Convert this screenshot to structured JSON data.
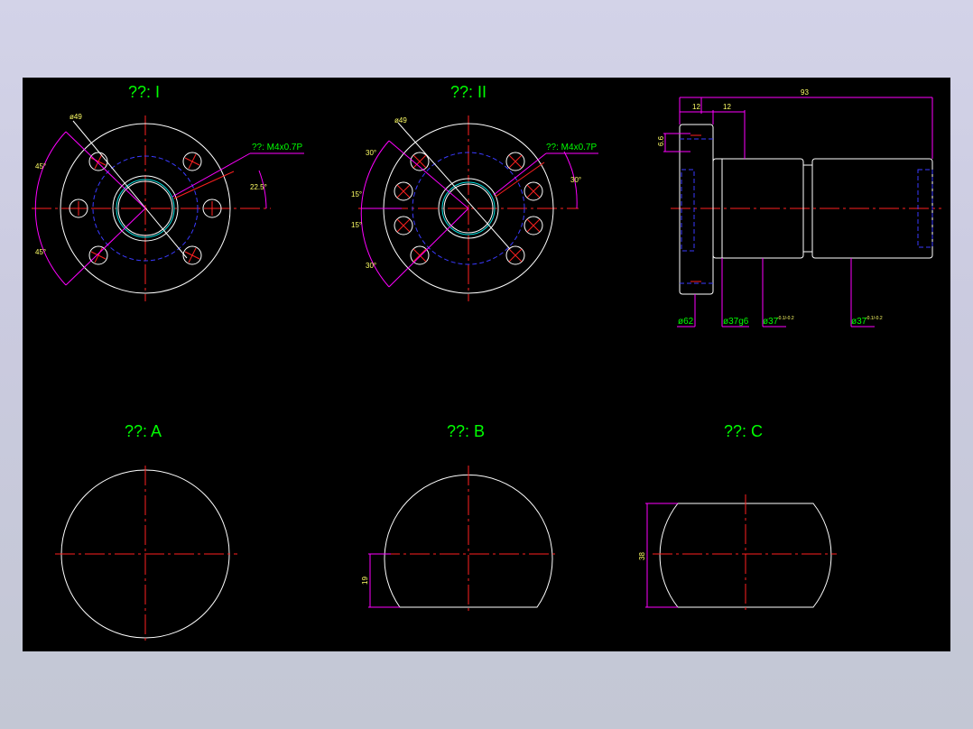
{
  "colors": {
    "background": "#000000",
    "outline": "#ffffff",
    "centerline": "#ff2020",
    "hidden": "#3a3aff",
    "dimension": "#ff00ff",
    "text": "#00ff00",
    "small_text": "#ffff66"
  },
  "views": {
    "view1_title": "??: I",
    "view2_title": "??: II",
    "viewA_title": "??: A",
    "viewB_title": "??: B",
    "viewC_title": "??: C"
  },
  "labels": {
    "v1_bolt_circle": "ø49",
    "v1_thread": "??: M4x0.7P",
    "v1_angle_top": "45°",
    "v1_angle_bottom": "45°",
    "v1_angle_thread": "22.5°",
    "v2_bolt_circle": "ø49",
    "v2_thread": "??: M4x0.7P",
    "v2_angle_a": "30°",
    "v2_angle_b": "15°",
    "v2_angle_c": "15°",
    "v2_angle_d": "30°",
    "v2_angle_thread": "30°",
    "side_dim_12a": "12",
    "side_dim_12b": "12",
    "side_dim_93": "93",
    "side_dim_66": "6.6",
    "side_dia_62": "ø62",
    "side_dia_37g6": "ø37g6",
    "side_dia_37a": "ø37",
    "side_dia_37b": "ø37",
    "side_tol_a": "-0.1/-0.2",
    "side_tol_b": "-0.1/-0.2",
    "b_height": "19",
    "c_height": "38"
  }
}
